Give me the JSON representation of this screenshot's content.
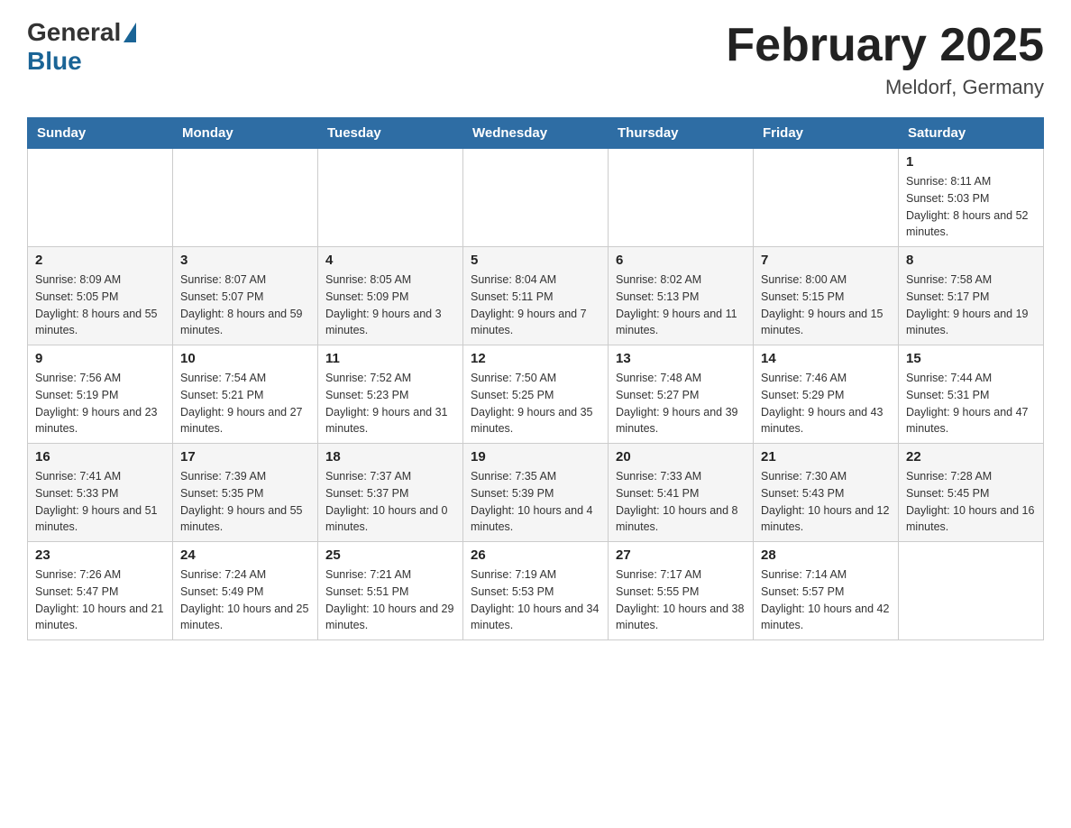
{
  "header": {
    "logo_general": "General",
    "logo_blue": "Blue",
    "month_title": "February 2025",
    "location": "Meldorf, Germany"
  },
  "days_of_week": [
    "Sunday",
    "Monday",
    "Tuesday",
    "Wednesday",
    "Thursday",
    "Friday",
    "Saturday"
  ],
  "weeks": [
    [
      {
        "day": "",
        "info": ""
      },
      {
        "day": "",
        "info": ""
      },
      {
        "day": "",
        "info": ""
      },
      {
        "day": "",
        "info": ""
      },
      {
        "day": "",
        "info": ""
      },
      {
        "day": "",
        "info": ""
      },
      {
        "day": "1",
        "info": "Sunrise: 8:11 AM\nSunset: 5:03 PM\nDaylight: 8 hours and 52 minutes."
      }
    ],
    [
      {
        "day": "2",
        "info": "Sunrise: 8:09 AM\nSunset: 5:05 PM\nDaylight: 8 hours and 55 minutes."
      },
      {
        "day": "3",
        "info": "Sunrise: 8:07 AM\nSunset: 5:07 PM\nDaylight: 8 hours and 59 minutes."
      },
      {
        "day": "4",
        "info": "Sunrise: 8:05 AM\nSunset: 5:09 PM\nDaylight: 9 hours and 3 minutes."
      },
      {
        "day": "5",
        "info": "Sunrise: 8:04 AM\nSunset: 5:11 PM\nDaylight: 9 hours and 7 minutes."
      },
      {
        "day": "6",
        "info": "Sunrise: 8:02 AM\nSunset: 5:13 PM\nDaylight: 9 hours and 11 minutes."
      },
      {
        "day": "7",
        "info": "Sunrise: 8:00 AM\nSunset: 5:15 PM\nDaylight: 9 hours and 15 minutes."
      },
      {
        "day": "8",
        "info": "Sunrise: 7:58 AM\nSunset: 5:17 PM\nDaylight: 9 hours and 19 minutes."
      }
    ],
    [
      {
        "day": "9",
        "info": "Sunrise: 7:56 AM\nSunset: 5:19 PM\nDaylight: 9 hours and 23 minutes."
      },
      {
        "day": "10",
        "info": "Sunrise: 7:54 AM\nSunset: 5:21 PM\nDaylight: 9 hours and 27 minutes."
      },
      {
        "day": "11",
        "info": "Sunrise: 7:52 AM\nSunset: 5:23 PM\nDaylight: 9 hours and 31 minutes."
      },
      {
        "day": "12",
        "info": "Sunrise: 7:50 AM\nSunset: 5:25 PM\nDaylight: 9 hours and 35 minutes."
      },
      {
        "day": "13",
        "info": "Sunrise: 7:48 AM\nSunset: 5:27 PM\nDaylight: 9 hours and 39 minutes."
      },
      {
        "day": "14",
        "info": "Sunrise: 7:46 AM\nSunset: 5:29 PM\nDaylight: 9 hours and 43 minutes."
      },
      {
        "day": "15",
        "info": "Sunrise: 7:44 AM\nSunset: 5:31 PM\nDaylight: 9 hours and 47 minutes."
      }
    ],
    [
      {
        "day": "16",
        "info": "Sunrise: 7:41 AM\nSunset: 5:33 PM\nDaylight: 9 hours and 51 minutes."
      },
      {
        "day": "17",
        "info": "Sunrise: 7:39 AM\nSunset: 5:35 PM\nDaylight: 9 hours and 55 minutes."
      },
      {
        "day": "18",
        "info": "Sunrise: 7:37 AM\nSunset: 5:37 PM\nDaylight: 10 hours and 0 minutes."
      },
      {
        "day": "19",
        "info": "Sunrise: 7:35 AM\nSunset: 5:39 PM\nDaylight: 10 hours and 4 minutes."
      },
      {
        "day": "20",
        "info": "Sunrise: 7:33 AM\nSunset: 5:41 PM\nDaylight: 10 hours and 8 minutes."
      },
      {
        "day": "21",
        "info": "Sunrise: 7:30 AM\nSunset: 5:43 PM\nDaylight: 10 hours and 12 minutes."
      },
      {
        "day": "22",
        "info": "Sunrise: 7:28 AM\nSunset: 5:45 PM\nDaylight: 10 hours and 16 minutes."
      }
    ],
    [
      {
        "day": "23",
        "info": "Sunrise: 7:26 AM\nSunset: 5:47 PM\nDaylight: 10 hours and 21 minutes."
      },
      {
        "day": "24",
        "info": "Sunrise: 7:24 AM\nSunset: 5:49 PM\nDaylight: 10 hours and 25 minutes."
      },
      {
        "day": "25",
        "info": "Sunrise: 7:21 AM\nSunset: 5:51 PM\nDaylight: 10 hours and 29 minutes."
      },
      {
        "day": "26",
        "info": "Sunrise: 7:19 AM\nSunset: 5:53 PM\nDaylight: 10 hours and 34 minutes."
      },
      {
        "day": "27",
        "info": "Sunrise: 7:17 AM\nSunset: 5:55 PM\nDaylight: 10 hours and 38 minutes."
      },
      {
        "day": "28",
        "info": "Sunrise: 7:14 AM\nSunset: 5:57 PM\nDaylight: 10 hours and 42 minutes."
      },
      {
        "day": "",
        "info": ""
      }
    ]
  ]
}
